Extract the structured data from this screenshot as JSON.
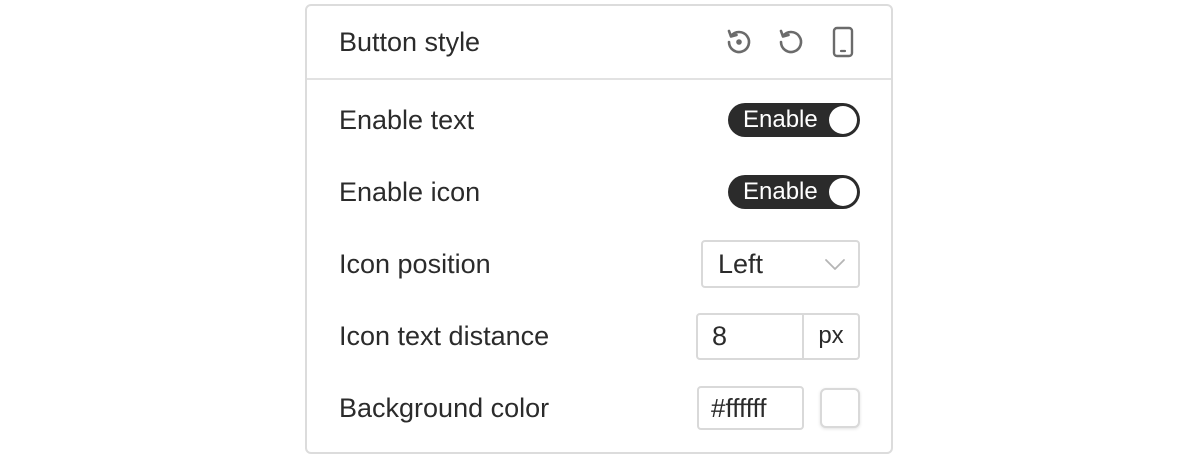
{
  "panel": {
    "title": "Button style",
    "header_icons": [
      "reset-dot-icon",
      "undo-icon",
      "mobile-icon"
    ]
  },
  "rows": {
    "enable_text": {
      "label": "Enable text",
      "toggle_label": "Enable",
      "on": true
    },
    "enable_icon": {
      "label": "Enable icon",
      "toggle_label": "Enable",
      "on": true
    },
    "icon_position": {
      "label": "Icon position",
      "value": "Left"
    },
    "icon_text_distance": {
      "label": "Icon text distance",
      "value": "8",
      "unit": "px"
    },
    "background_color": {
      "label": "Background color",
      "value": "#ffffff",
      "swatch": "#ffffff"
    }
  },
  "colors": {
    "toggle_bg": "#2b2b2b",
    "border": "#d9d9d9",
    "text": "#2b2b2b"
  }
}
